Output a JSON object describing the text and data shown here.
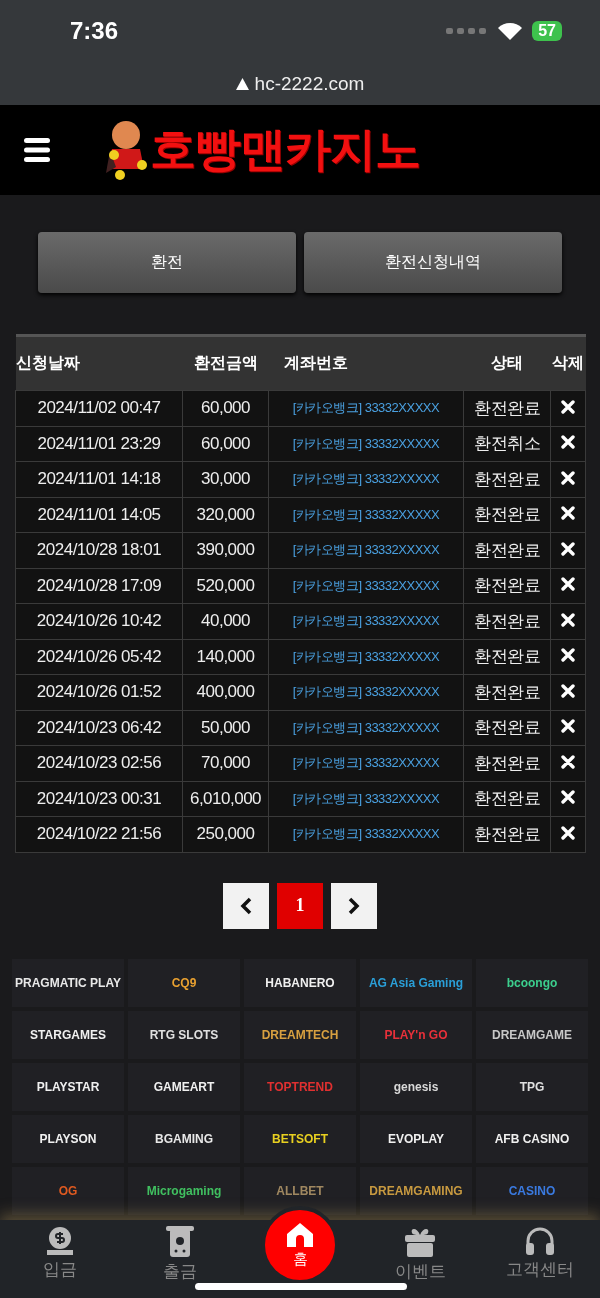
{
  "status_bar": {
    "time": "7:36",
    "battery": "57"
  },
  "browser": {
    "url": "hc-2222.com"
  },
  "header": {
    "logo": "호빵맨카지노"
  },
  "tabs": [
    {
      "label": "환전",
      "selected": false
    },
    {
      "label": "환전신청내역",
      "selected": false
    }
  ],
  "table": {
    "columns": [
      "신청날짜",
      "환전금액",
      "계좌번호",
      "상태",
      "삭제"
    ],
    "rows": [
      {
        "date": "2024/11/02 00:47",
        "amount": "60,000",
        "account": "[카카오뱅크] 33332XXXXX",
        "status": "환전완료"
      },
      {
        "date": "2024/11/01 23:29",
        "amount": "60,000",
        "account": "[카카오뱅크] 33332XXXXX",
        "status": "환전취소"
      },
      {
        "date": "2024/11/01 14:18",
        "amount": "30,000",
        "account": "[카카오뱅크] 33332XXXXX",
        "status": "환전완료"
      },
      {
        "date": "2024/11/01 14:05",
        "amount": "320,000",
        "account": "[카카오뱅크] 33332XXXXX",
        "status": "환전완료"
      },
      {
        "date": "2024/10/28 18:01",
        "amount": "390,000",
        "account": "[카카오뱅크] 33332XXXXX",
        "status": "환전완료"
      },
      {
        "date": "2024/10/28 17:09",
        "amount": "520,000",
        "account": "[카카오뱅크] 33332XXXXX",
        "status": "환전완료"
      },
      {
        "date": "2024/10/26 10:42",
        "amount": "40,000",
        "account": "[카카오뱅크] 33332XXXXX",
        "status": "환전완료"
      },
      {
        "date": "2024/10/26 05:42",
        "amount": "140,000",
        "account": "[카카오뱅크] 33332XXXXX",
        "status": "환전완료"
      },
      {
        "date": "2024/10/26 01:52",
        "amount": "400,000",
        "account": "[카카오뱅크] 33332XXXXX",
        "status": "환전완료"
      },
      {
        "date": "2024/10/23 06:42",
        "amount": "50,000",
        "account": "[카카오뱅크] 33332XXXXX",
        "status": "환전완료"
      },
      {
        "date": "2024/10/23 02:56",
        "amount": "70,000",
        "account": "[카카오뱅크] 33332XXXXX",
        "status": "환전완료"
      },
      {
        "date": "2024/10/23 00:31",
        "amount": "6,010,000",
        "account": "[카카오뱅크] 33332XXXXX",
        "status": "환전완료"
      },
      {
        "date": "2024/10/22 21:56",
        "amount": "250,000",
        "account": "[카카오뱅크] 33332XXXXX",
        "status": "환전완료"
      }
    ]
  },
  "pagination": {
    "pages": [
      {
        "label": "1",
        "selected": true
      }
    ]
  },
  "providers": [
    {
      "name": "PRAGMATIC PLAY",
      "color": "#e8e8e8"
    },
    {
      "name": "CQ9",
      "color": "#e8a030"
    },
    {
      "name": "HABANERO",
      "color": "#f0f0f0"
    },
    {
      "name": "AG Asia Gaming",
      "color": "#2a9fd8"
    },
    {
      "name": "bcoongo",
      "color": "#3ccf8e"
    },
    {
      "name": "STARGAMES",
      "color": "#f0f0f0"
    },
    {
      "name": "RTG SLOTS",
      "color": "#e0e0e0"
    },
    {
      "name": "DREAMTECH",
      "color": "#d8a040"
    },
    {
      "name": "PLAY'n GO",
      "color": "#e8303a"
    },
    {
      "name": "DREAMGAME",
      "color": "#c8c8c8"
    },
    {
      "name": "PLAYSTAR",
      "color": "#f0f0f0"
    },
    {
      "name": "GAMEART",
      "color": "#f0f0f0"
    },
    {
      "name": "TOPTREND",
      "color": "#e03030"
    },
    {
      "name": "genesis",
      "color": "#d8d8d8"
    },
    {
      "name": "TPG",
      "color": "#e0e0e0"
    },
    {
      "name": "PLAYSON",
      "color": "#f0f0f0"
    },
    {
      "name": "BGAMING",
      "color": "#e8e8e8"
    },
    {
      "name": "BETSOFT",
      "color": "#e8d020"
    },
    {
      "name": "EVOPLAY",
      "color": "#f0f0f0"
    },
    {
      "name": "AFB CASINO",
      "color": "#f0f0f0"
    },
    {
      "name": "OG",
      "color": "#e05a20"
    },
    {
      "name": "Microgaming",
      "color": "#40c060"
    },
    {
      "name": "ALLBET",
      "color": "#a08860"
    },
    {
      "name": "DREAMGAMING",
      "color": "#c89a40"
    },
    {
      "name": "CASINO",
      "color": "#3a7ae0"
    }
  ],
  "bottom_nav": [
    {
      "label": "입금",
      "selected": false
    },
    {
      "label": "출금",
      "selected": false
    },
    {
      "label": "홈",
      "selected": true
    },
    {
      "label": "이벤트",
      "selected": false
    },
    {
      "label": "고객센터",
      "selected": false
    }
  ]
}
